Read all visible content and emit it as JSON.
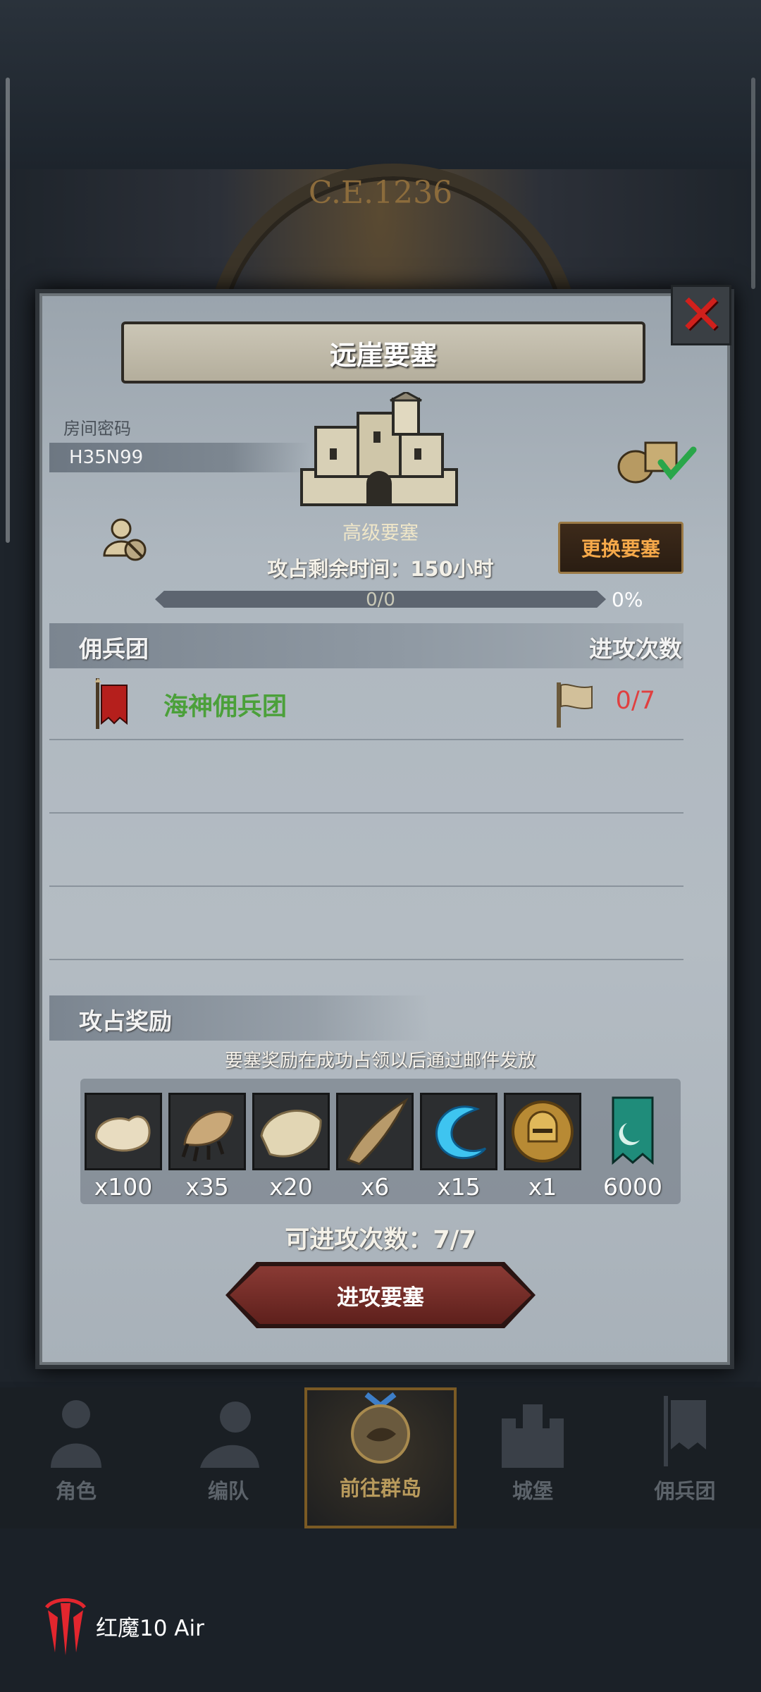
{
  "background": {
    "era": "C.E.1236"
  },
  "dialog": {
    "title": "远崖要塞",
    "room_code_label": "房间密码",
    "room_code": "H35N99",
    "fort_level": "高级要塞",
    "change_button": "更换要塞",
    "time_remaining": "攻占剩余时间：150小时",
    "progress": {
      "text": "0/0",
      "percent_label": "0%",
      "fraction": 0
    },
    "mercenary_header": "佣兵团",
    "attack_count_header": "进攻次数",
    "mercenaries": [
      {
        "name": "海神佣兵团",
        "attacks": "0/7"
      }
    ],
    "rewards_header": "攻占奖励",
    "rewards_note": "要塞奖励在成功占领以后通过邮件发放",
    "rewards": [
      {
        "icon": "fur-pelt-icon",
        "qty": "x100"
      },
      {
        "icon": "claw-icon",
        "qty": "x35"
      },
      {
        "icon": "hide-icon",
        "qty": "x20"
      },
      {
        "icon": "horn-icon",
        "qty": "x6"
      },
      {
        "icon": "blue-wave-icon",
        "qty": "x15"
      },
      {
        "icon": "knight-helmet-medal-icon",
        "qty": "x1"
      },
      {
        "icon": "teal-banner-icon",
        "qty": "6000"
      }
    ],
    "attempts": "可进攻次数：7/7",
    "attack_button": "进攻要塞"
  },
  "nav": [
    {
      "label": "角色",
      "icon": "knight-icon"
    },
    {
      "label": "编队",
      "icon": "formation-icon"
    },
    {
      "label": "前往群岛",
      "icon": "island-compass-icon",
      "active": true
    },
    {
      "label": "城堡",
      "icon": "castle-icon"
    },
    {
      "label": "佣兵团",
      "icon": "mercenary-icon"
    }
  ],
  "device": {
    "brand": "红魔10 Air"
  },
  "colors": {
    "accent_orange": "#f6a94a",
    "merc_green": "#4ba03a",
    "attack_red": "#e04040"
  }
}
